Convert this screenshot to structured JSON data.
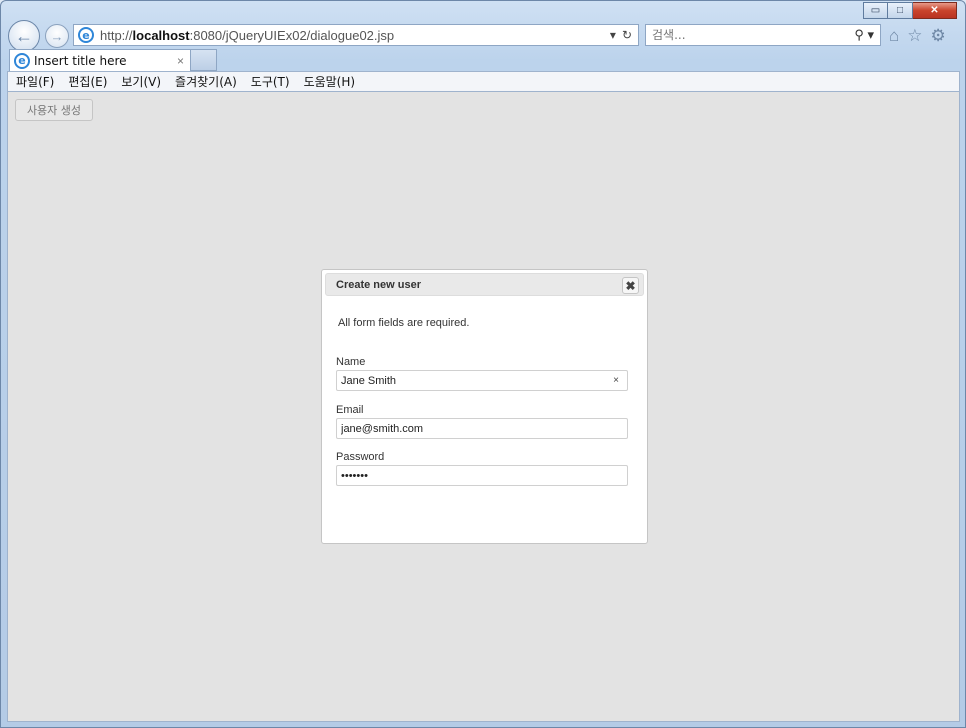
{
  "window": {
    "controls": {
      "minimize": "▭",
      "maximize": "□",
      "close": "✕"
    }
  },
  "nav": {
    "back_icon": "←",
    "forward_icon": "→",
    "address": {
      "protocol": "http://",
      "host": "localhost",
      "path": ":8080/jQueryUIEx02/dialogue02.jsp",
      "dropdown_icon": "▾",
      "refresh_icon": "↻"
    },
    "search": {
      "placeholder": "검색...",
      "search_icon": "⚲",
      "dropdown_icon": "▾"
    },
    "icons": {
      "home": "⌂",
      "favorites": "☆",
      "tools": "⚙"
    }
  },
  "tab": {
    "title": "Insert title here",
    "close": "×"
  },
  "menu": [
    "파일(F)",
    "편집(E)",
    "보기(V)",
    "즐겨찾기(A)",
    "도구(T)",
    "도움말(H)"
  ],
  "page": {
    "create_user_button": "사용자 생성"
  },
  "dialog": {
    "title": "Create new user",
    "close_icon": "✖",
    "tip": "All form fields are required.",
    "fields": {
      "name": {
        "label": "Name",
        "value": "Jane Smith",
        "clear": "×"
      },
      "email": {
        "label": "Email",
        "value": "jane@smith.com"
      },
      "password": {
        "label": "Password",
        "value": "•••••••"
      }
    }
  }
}
